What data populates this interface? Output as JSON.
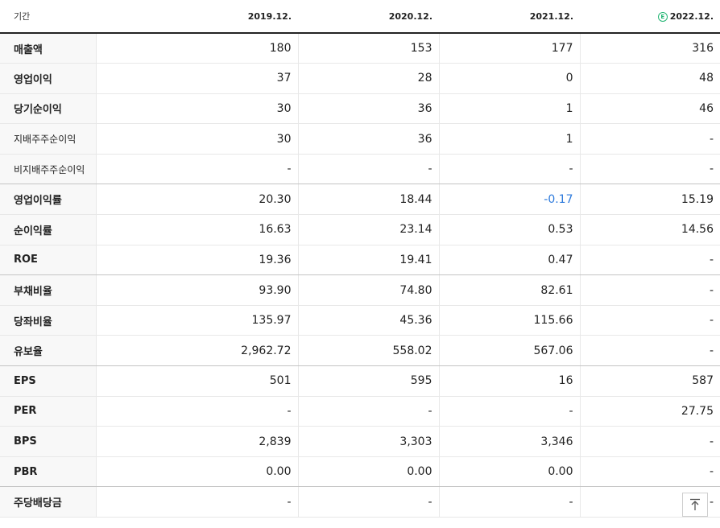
{
  "header": {
    "label": "기간",
    "periods": [
      "2019.12.",
      "2020.12.",
      "2021.12.",
      "2022.12."
    ],
    "estimate_badge": "E"
  },
  "rows": [
    {
      "label": "매출액",
      "values": [
        "180",
        "153",
        "177",
        "316"
      ]
    },
    {
      "label": "영업이익",
      "values": [
        "37",
        "28",
        "0",
        "48"
      ]
    },
    {
      "label": "당기순이익",
      "values": [
        "30",
        "36",
        "1",
        "46"
      ]
    },
    {
      "label": "지배주주순이익",
      "values": [
        "30",
        "36",
        "1",
        "-"
      ]
    },
    {
      "label": "비지배주주순이익",
      "values": [
        "-",
        "-",
        "-",
        "-"
      ]
    },
    {
      "label": "영업이익률",
      "values": [
        "20.30",
        "18.44",
        "-0.17",
        "15.19"
      ]
    },
    {
      "label": "순이익률",
      "values": [
        "16.63",
        "23.14",
        "0.53",
        "14.56"
      ]
    },
    {
      "label": "ROE",
      "values": [
        "19.36",
        "19.41",
        "0.47",
        "-"
      ]
    },
    {
      "label": "부채비율",
      "values": [
        "93.90",
        "74.80",
        "82.61",
        "-"
      ]
    },
    {
      "label": "당좌비율",
      "values": [
        "135.97",
        "45.36",
        "115.66",
        "-"
      ]
    },
    {
      "label": "유보율",
      "values": [
        "2,962.72",
        "558.02",
        "567.06",
        "-"
      ]
    },
    {
      "label": "EPS",
      "values": [
        "501",
        "595",
        "16",
        "587"
      ]
    },
    {
      "label": "PER",
      "values": [
        "-",
        "-",
        "-",
        "27.75"
      ]
    },
    {
      "label": "BPS",
      "values": [
        "2,839",
        "3,303",
        "3,346",
        "-"
      ]
    },
    {
      "label": "PBR",
      "values": [
        "0.00",
        "0.00",
        "0.00",
        "-"
      ]
    },
    {
      "label": "주당배당금",
      "values": [
        "-",
        "-",
        "-",
        "-"
      ]
    }
  ],
  "colors": {
    "negative": "#2f7bdc",
    "estimate": "#22b573"
  },
  "icons": {
    "top": "arrow-up-to-line-icon"
  }
}
